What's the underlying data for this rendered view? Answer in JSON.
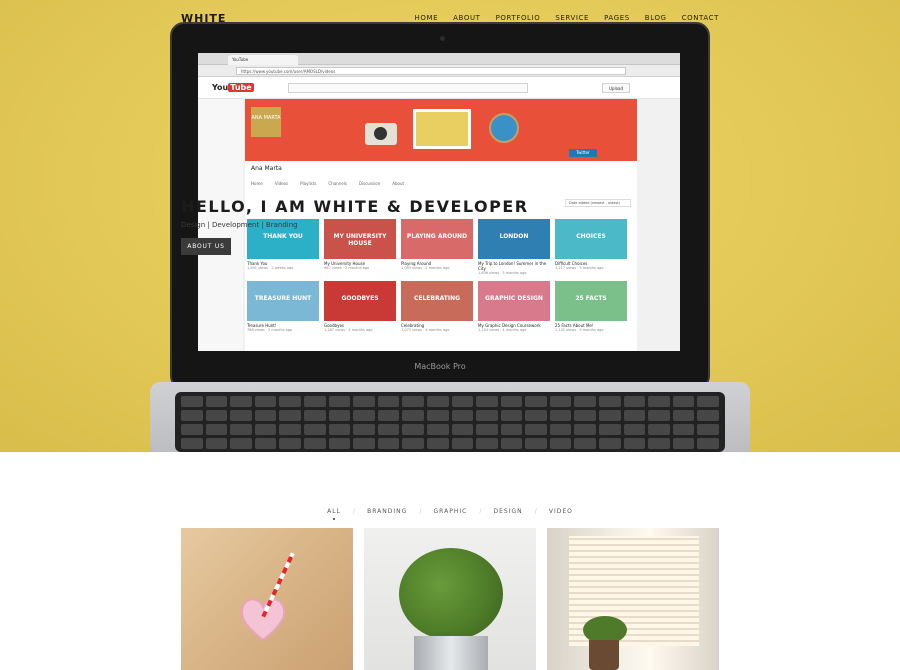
{
  "nav": {
    "logo": "WHITE",
    "items": [
      "HOME",
      "ABOUT",
      "PORTFOLIO",
      "SERVICE",
      "PAGES",
      "BLOG",
      "CONTACT"
    ]
  },
  "hero": {
    "title": "HELLO, I AM WHITE & DEVELOPER",
    "subtitle": "Design | Development | Branding",
    "button": "ABOUT US"
  },
  "laptop": {
    "brand": "MacBook Pro",
    "browser": {
      "tab": "YouTube",
      "url": "https://www.youtube.com/user/AMOSLD/videos"
    },
    "youtube": {
      "logo_you": "You",
      "logo_tube": "Tube",
      "upload": "Upload",
      "banner_name": "ANA MARTA",
      "twitter": "Twitter",
      "channel_name": "Ana Marta",
      "tabs": [
        "Home",
        "Videos",
        "Playlists",
        "Channels",
        "Discussion",
        "About"
      ],
      "sort": "Date added (newest - oldest)",
      "videos": [
        {
          "thumb": "THANK YOU",
          "title": "Thank You",
          "meta": "1,891 views · 2 weeks ago",
          "color": "#2bb0c8"
        },
        {
          "thumb": "MY UNIVERSITY HOUSE",
          "title": "My University House",
          "meta": "967 views · 2 months ago",
          "color": "#c9524a"
        },
        {
          "thumb": "PLAYING AROUND",
          "title": "Playing Around",
          "meta": "1,093 views · 2 months ago",
          "color": "#d96a6a"
        },
        {
          "thumb": "LONDON",
          "title": "My Trip to London! Summer in the City",
          "meta": "1,836 views · 3 months ago",
          "color": "#2f7fb2"
        },
        {
          "thumb": "CHOICES",
          "title": "Difficult Choices",
          "meta": "1,117 views · 3 months ago",
          "color": "#4bb9c7"
        },
        {
          "thumb": "TREASURE HUNT",
          "title": "Treasure Hunt!",
          "meta": "786 views · 3 months ago",
          "color": "#7ab8d6"
        },
        {
          "thumb": "GOODBYES",
          "title": "Goodbyes",
          "meta": "1,287 views · 4 months ago",
          "color": "#c93a36"
        },
        {
          "thumb": "CELEBRATING",
          "title": "Celebrating",
          "meta": "1,073 views · 4 months ago",
          "color": "#c96b5b"
        },
        {
          "thumb": "GRAPHIC DESIGN",
          "title": "My Graphic Design Coursework",
          "meta": "1,204 views · 4 months ago",
          "color": "#d97a8c"
        },
        {
          "thumb": "25 FACTS",
          "title": "25 Facts About Me!",
          "meta": "1,141 views · 5 months ago",
          "color": "#7bbf8a"
        }
      ]
    }
  },
  "portfolio": {
    "filters": [
      "ALL",
      "BRANDING",
      "GRAPHIC",
      "DESIGN",
      "VIDEO"
    ],
    "active_filter": "ALL"
  }
}
